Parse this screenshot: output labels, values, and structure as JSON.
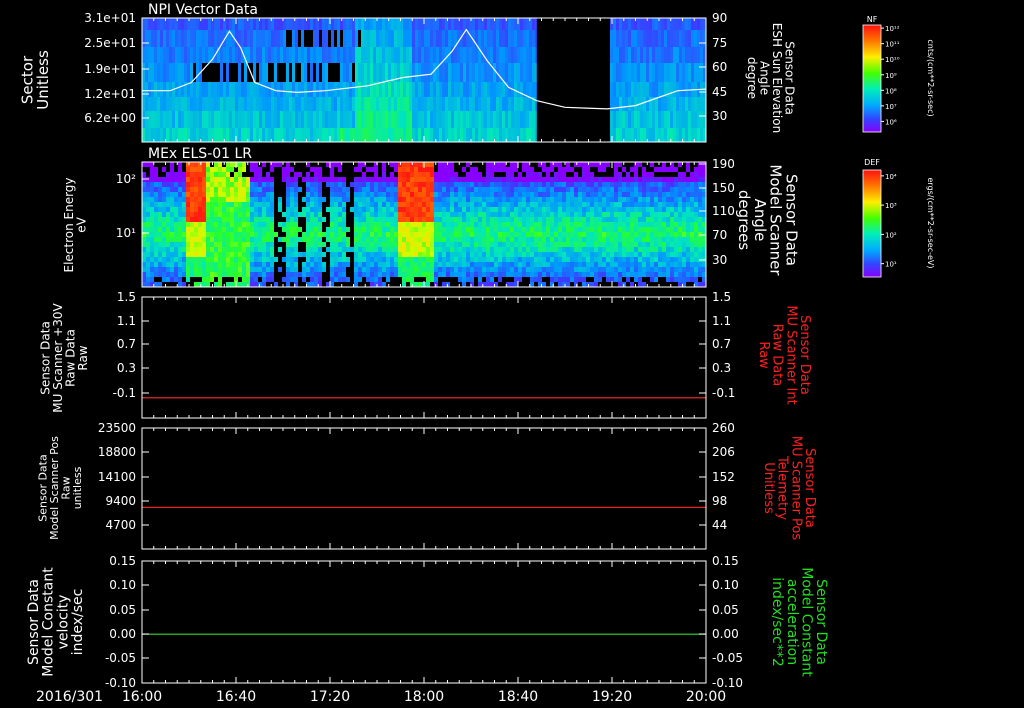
{
  "date_label": "2016/301",
  "time_ticks": [
    "16:00",
    "16:40",
    "17:20",
    "18:00",
    "18:40",
    "19:20",
    "20:00"
  ],
  "colors": {
    "background": "#000000",
    "axis": "#ffffff",
    "red_line": "#ff2a2a",
    "green_line": "#33dd33",
    "red_label": "#ff2020",
    "green_label": "#22dd22"
  },
  "chart_data": [
    {
      "type": "heatmap",
      "title": "NPI Vector Data",
      "ylabel": "Sector Unitless",
      "y_ticks": [
        "3.1e+01",
        "2.5e+01",
        "1.9e+01",
        "1.2e+01",
        "6.2e+00"
      ],
      "right_ylabel": "Sensor Data ESH Sun Elevation Angle degree",
      "right_y_ticks": [
        "90",
        "75",
        "60",
        "45",
        "30"
      ],
      "right_ylim": [
        15,
        90
      ],
      "colorbar_title": "NF",
      "colorbar_units": "cnts/(cm**2-sr-sec)",
      "colorbar_ticks": [
        "10¹²",
        "10¹¹",
        "10¹⁰",
        "10⁹",
        "10⁸",
        "10⁷",
        "10⁶"
      ],
      "overlay_line": {
        "name": "Sun Elevation Angle",
        "x_hours": [
          16.0,
          16.2,
          16.35,
          16.5,
          16.62,
          16.7,
          16.8,
          16.95,
          17.1,
          17.3,
          17.6,
          17.85,
          18.05,
          18.2,
          18.3,
          18.45,
          18.6,
          18.8,
          19.0,
          19.15,
          19.3,
          19.5,
          19.8,
          20.0
        ],
        "y_degrees": [
          46,
          46,
          51,
          65,
          82,
          72,
          51,
          46,
          45,
          46,
          49,
          54,
          56,
          70,
          83,
          64,
          48,
          40,
          36,
          35.5,
          35,
          37,
          46,
          47
        ]
      },
      "data_gaps": [
        {
          "start": "18:48",
          "end": "19:18"
        }
      ]
    },
    {
      "type": "heatmap",
      "title": "MEx ELS-01 LR",
      "ylabel": "Electron Energy eV",
      "y_ticks": [
        "10²",
        "10¹"
      ],
      "right_ylabel": "Sensor Data Model Scanner Angle degrees",
      "right_y_ticks": [
        "190",
        "150",
        "110",
        "70",
        "30"
      ],
      "colorbar_title": "DEF",
      "colorbar_units": "ergs/(cm**2-sr-sec-eV)",
      "colorbar_ticks": [
        "10⁴",
        "10³",
        "10²",
        "10¹"
      ]
    },
    {
      "type": "line",
      "ylabel": "Sensor Data MU Scanner +30V Raw Data Raw",
      "y_ticks": [
        "1.5",
        "1.1",
        "0.7",
        "0.3",
        "-0.1"
      ],
      "ylim": [
        -0.3,
        1.5
      ],
      "right_ylabel": "Sensor Data MU Scanner Int Raw Data Raw",
      "right_y_ticks": [
        "1.5",
        "1.1",
        "0.7",
        "0.3",
        "-0.1"
      ],
      "series": [
        {
          "values": [
            0.0,
            0.0
          ]
        }
      ],
      "line_color": "red"
    },
    {
      "type": "line",
      "ylabel": "Sensor Data Model Scanner Pos Raw unitless",
      "y_ticks": [
        "23500",
        "18800",
        "14100",
        "9400",
        "4700"
      ],
      "ylim": [
        0,
        23500
      ],
      "right_ylabel": "Sensor Data MU Scanner Pos Telemetry Unitless",
      "right_y_ticks": [
        "260",
        "206",
        "152",
        "98",
        "44"
      ],
      "series": [
        {
          "values": [
            8100,
            8100
          ]
        }
      ],
      "line_color": "red"
    },
    {
      "type": "line",
      "ylabel": "Sensor Data Model Constant velocity index/sec",
      "y_ticks": [
        "0.15",
        "0.10",
        "0.05",
        "0.00",
        "-0.05",
        "-0.10"
      ],
      "ylim": [
        -0.1,
        0.15
      ],
      "right_ylabel": "Sensor Data Model Constant acceleration index/sec**2",
      "right_y_ticks": [
        "0.15",
        "0.10",
        "0.05",
        "0.00",
        "-0.05",
        "-0.10"
      ],
      "series": [
        {
          "values": [
            0.0,
            0.0
          ]
        }
      ],
      "line_color": "green"
    }
  ]
}
